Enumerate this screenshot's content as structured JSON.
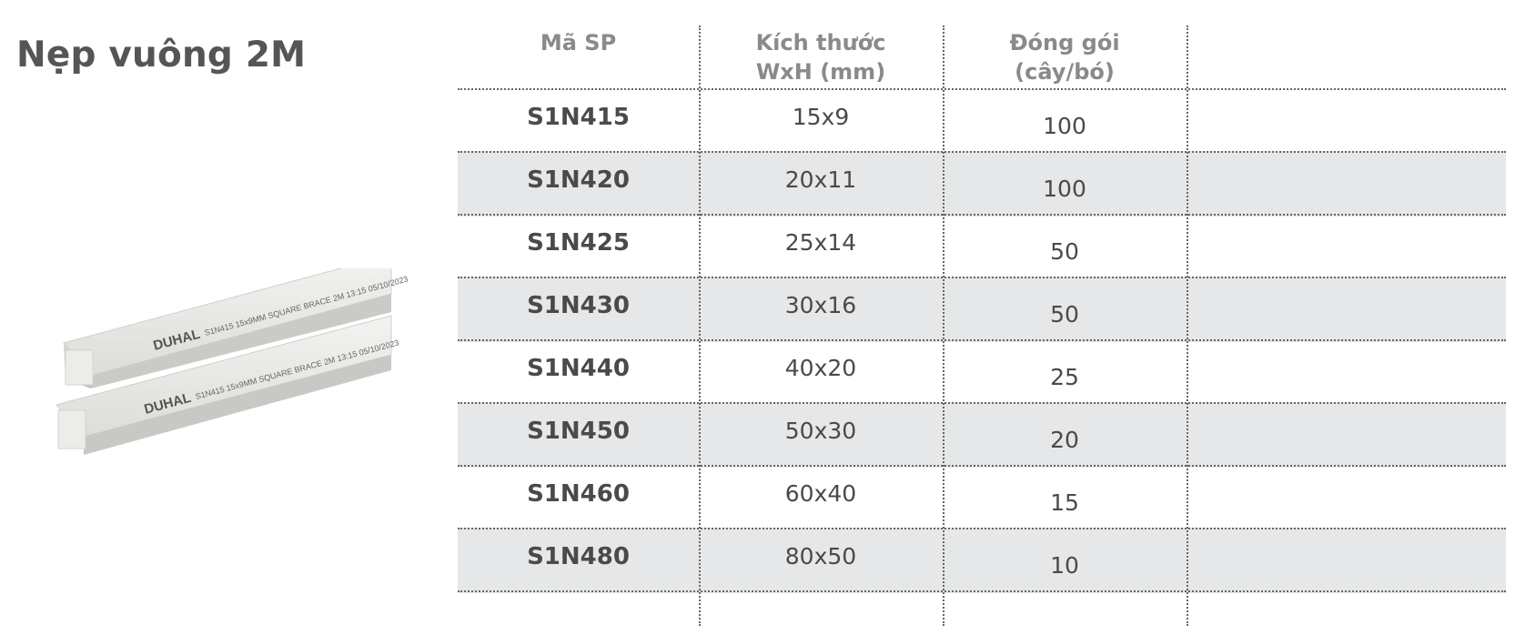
{
  "title": "Nẹp vuông 2M",
  "product_image": {
    "brand": "DUHAL",
    "print_text": "S1N415  15x9MM  SQUARE BRACE 2M  13:15  05/10/2023"
  },
  "table": {
    "headers": {
      "code": "Mã SP",
      "size_line1": "Kích thước",
      "size_line2": "WxH (mm)",
      "pack_line1": "Đóng gói",
      "pack_line2": "(cây/bó)"
    },
    "rows": [
      {
        "code": "S1N415",
        "size": "15x9",
        "pack": "100"
      },
      {
        "code": "S1N420",
        "size": "20x11",
        "pack": "100"
      },
      {
        "code": "S1N425",
        "size": "25x14",
        "pack": "50"
      },
      {
        "code": "S1N430",
        "size": "30x16",
        "pack": "50"
      },
      {
        "code": "S1N440",
        "size": "40x20",
        "pack": "25"
      },
      {
        "code": "S1N450",
        "size": "50x30",
        "pack": "20"
      },
      {
        "code": "S1N460",
        "size": "60x40",
        "pack": "15"
      },
      {
        "code": "S1N480",
        "size": "80x50",
        "pack": "10"
      }
    ]
  }
}
